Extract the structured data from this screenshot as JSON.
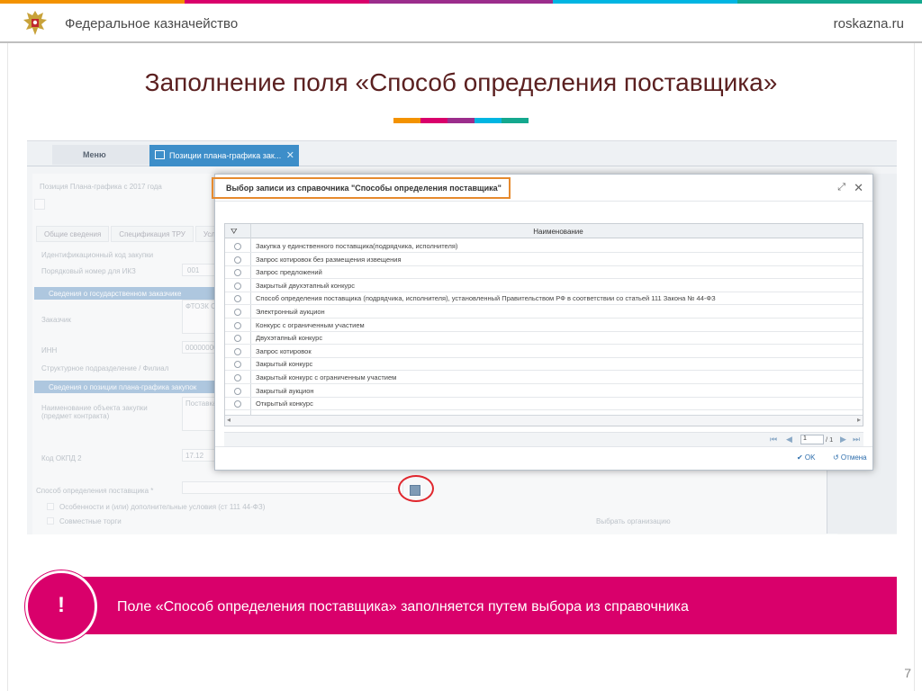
{
  "header": {
    "org_name": "Федеральное казначейство",
    "site": "roskazna.ru"
  },
  "colors": {
    "stripe": [
      "#f39200",
      "#d9006b",
      "#9b2d8c",
      "#00b5e2",
      "#14a88e"
    ],
    "callout": "#d9006b",
    "title": "#5b2020"
  },
  "slide": {
    "title": "Заполнение поля «Способ определения поставщика»",
    "page_number": "7"
  },
  "app": {
    "menu_label": "Меню",
    "active_tab_label": "Позиции плана-графика зак...",
    "active_tab_close": "✕",
    "breadcrumb": "Позиция Плана-графика с 2017 года",
    "tabs": [
      "Общие сведения",
      "Спецификация ТРУ",
      "Усло"
    ],
    "fields": {
      "ident_code": "Идентификационный код закупки",
      "order_no": "Порядковый номер для ИКЗ",
      "order_no_value": "001",
      "section_state": "Сведения о государственном заказчике",
      "customer": "Заказчик",
      "customer_value": "ФТОЗК С",
      "inn": "ИНН",
      "inn_value": "00000000",
      "struct_unit": "Структурное подразделение / Филиал",
      "section_plan": "Сведения о позиции плана-графика закупок",
      "object_name": "Наименование объекта закупки (предмет контракта)",
      "object_value": "Поставка",
      "okpd": "Код ОКПД 2",
      "okpd_value": "17.12",
      "method": "Способ определения поставщика *",
      "features": "Особенности и (или) дополнительные условия (ст 111 44-ФЗ)",
      "joint": "Совместные торги",
      "choose_org": "Выбрать организацию"
    }
  },
  "dialog": {
    "title": "Выбор записи из справочника \"Способы определения поставщика\"",
    "expand_icon": "⤢",
    "close_icon": "✕",
    "filter_icon": "⛛",
    "column_header": "Наименование",
    "rows": [
      "Закупка у единственного поставщика(подрядчика, исполнителя)",
      "Запрос котировок без размещения извещения",
      "Запрос предложений",
      "Закрытый двухэтапный конкурс",
      "Способ определения поставщика (подрядчика, исполнителя), установленный Правительством РФ в соответствии со статьей 111 Закона № 44-ФЗ",
      "Электронный аукцион",
      "Конкурс с ограниченным участием",
      "Двухэтапный конкурс",
      "Запрос котировок",
      "Закрытый конкурс",
      "Закрытый конкурс с ограниченным участием",
      "Закрытый аукцион",
      "Открытый конкурс"
    ],
    "pager": {
      "first": "⏮",
      "prev": "◀",
      "page": "1",
      "total": "/ 1",
      "next": "▶",
      "last": "⏭"
    },
    "ok_label": "✔ OK",
    "cancel_label": "↺ Отмена"
  },
  "callout": {
    "icon": "!",
    "text": "Поле «Способ определения поставщика» заполняется путем выбора из справочника"
  }
}
